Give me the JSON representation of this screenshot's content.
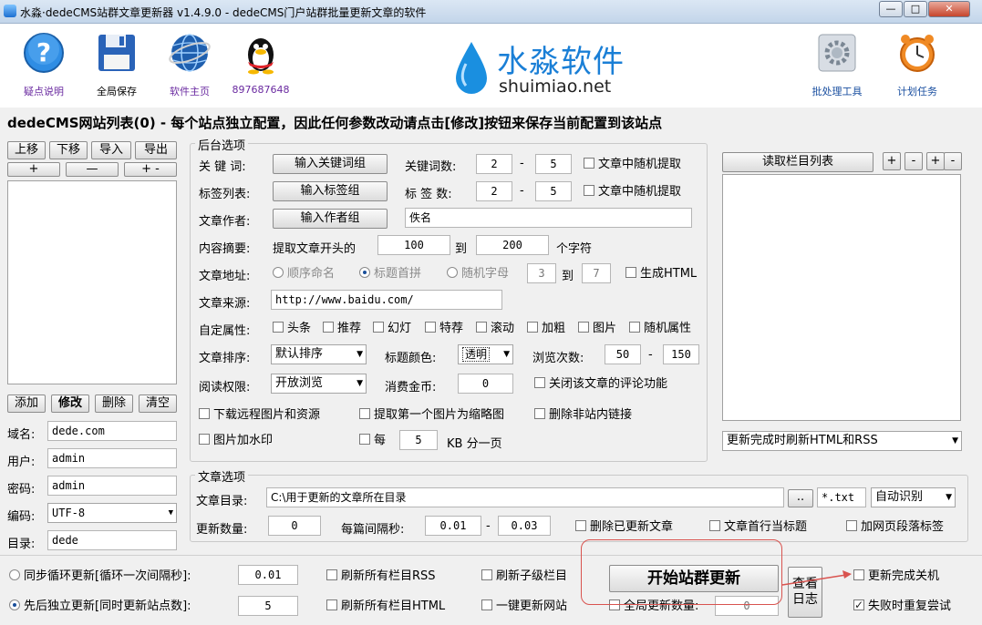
{
  "window": {
    "title": "水淼·dedeCMS站群文章更新器 v1.4.9.0 - dedeCMS门户站群批量更新文章的软件",
    "buttons": [
      "—",
      "□",
      "✕"
    ]
  },
  "toolbar": {
    "items": [
      {
        "label": "疑点说明",
        "icon": "help-icon"
      },
      {
        "label": "全局保存",
        "icon": "floppy-disk-icon"
      },
      {
        "label": "软件主页",
        "icon": "globe-icon"
      },
      {
        "label": "897687648",
        "icon": "qq-penguin-icon"
      },
      {
        "label": "批处理工具",
        "icon": "batch-gear-icon"
      },
      {
        "label": "计划任务",
        "icon": "alarm-clock-icon"
      }
    ],
    "logo_cn": "水淼软件",
    "logo_en": "shuimiao.net"
  },
  "headline": "dedeCMS网站列表(0)  - 每个站点独立配置，因此任何参数改动请点击[修改]按钮来保存当前配置到该站点",
  "left": {
    "move_up": "上移",
    "move_down": "下移",
    "import": "导入",
    "export": "导出",
    "plus": "+",
    "minus": "—",
    "plus_minus": "+ -",
    "add": "添加",
    "modify": "修改",
    "delete": "删除",
    "clear": "清空",
    "domain_label": "域名:",
    "domain_value": "dede.com",
    "user_label": "用户:",
    "user_value": "admin",
    "password_label": "密码:",
    "password_value": "admin",
    "encoding_label": "编码:",
    "encoding_value": "UTF-8",
    "dir_label": "目录:",
    "dir_value": "dede"
  },
  "backend": {
    "title": "后台选项",
    "keyword_label": "关 键 词:",
    "keyword_btn": "输入关键词组",
    "keyword_count_label": "关键词数:",
    "keyword_min": "2",
    "keyword_max": "5",
    "random_pick": "文章中随机提取",
    "tag_label": "标签列表:",
    "tag_btn": "输入标签组",
    "tag_count_label": "标 签 数:",
    "tag_min": "2",
    "tag_max": "5",
    "author_label": "文章作者:",
    "author_btn": "输入作者组",
    "author_value": "佚名",
    "summary_label": "内容摘要:",
    "summary_text": "提取文章开头的",
    "summary_min": "100",
    "summary_to": "到",
    "summary_max": "200",
    "summary_unit": "个字符",
    "url_label": "文章地址:",
    "url_seq": "顺序命名",
    "url_title": "标题首拼",
    "url_random": "随机字母",
    "url_rand_min": "3",
    "url_rand_to": "到",
    "url_rand_max": "7",
    "gen_html": "生成HTML",
    "source_label": "文章来源:",
    "source_value": "http://www.baidu.com/",
    "attr_label": "自定属性:",
    "attrs": [
      "头条",
      "推荐",
      "幻灯",
      "特荐",
      "滚动",
      "加粗",
      "图片",
      "随机属性"
    ],
    "sort_label": "文章排序:",
    "sort_value": "默认排序",
    "title_color_label": "标题颜色:",
    "title_color_value": "透明",
    "views_label": "浏览次数:",
    "views_min": "50",
    "views_max": "150",
    "read_label": "阅读权限:",
    "read_value": "开放浏览",
    "coins_label": "消费金币:",
    "coins_value": "0",
    "close_comments": "关闭该文章的评论功能",
    "download_remote": "下载远程图片和资源",
    "first_img_thumb": "提取第一个图片为缩略图",
    "remove_external": "删除非站内链接",
    "watermark": "图片加水印",
    "per_label": "每",
    "per_value": "5",
    "per_unit": "KB 分一页"
  },
  "category": {
    "read_btn": "读取栏目列表",
    "small_btns": [
      "+",
      "-",
      "+",
      "-"
    ],
    "refresh_select": "更新完成时刷新HTML和RSS"
  },
  "article": {
    "title": "文章选项",
    "dir_label": "文章目录:",
    "dir_value": "C:\\用于更新的文章所在目录",
    "browse": "..",
    "ext": "*.txt",
    "encoding": "自动识别",
    "count_label": "更新数量:",
    "count_value": "0",
    "interval_label": "每篇间隔秒:",
    "interval_min": "0.01",
    "interval_max": "0.03",
    "delete_updated": "删除已更新文章",
    "first_line_title": "文章首行当标题",
    "add_para_tags": "加网页段落标签"
  },
  "bottom": {
    "sync_loop": "同步循环更新[循环一次间隔秒]:",
    "sync_value": "0.01",
    "sequential": "先后独立更新[同时更新站点数]:",
    "seq_value": "5",
    "refresh_rss": "刷新所有栏目RSS",
    "refresh_sub": "刷新子级栏目",
    "refresh_html": "刷新所有栏目HTML",
    "one_key": "一键更新网站",
    "global_count_label": "全局更新数量:",
    "global_count_value": "0",
    "start_btn": "开始站群更新",
    "log_btn": "查看日志",
    "shutdown": "更新完成关机",
    "retry": "失败时重复尝试"
  },
  "colors": {
    "accent": "#1a7fd6",
    "highlight": "#d9534f"
  }
}
